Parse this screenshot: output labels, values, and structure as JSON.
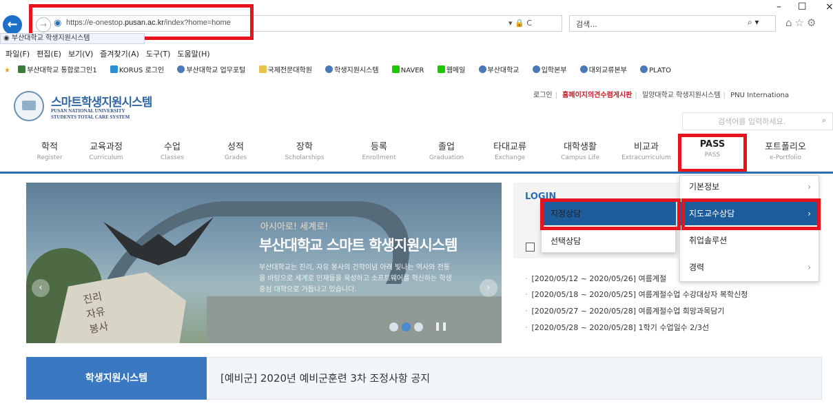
{
  "browser": {
    "url_host": "https://e-onestop.",
    "url_domain": "pusan.ac.kr",
    "url_path": "/index?home=home",
    "addr_tools": "▾ 🔒 C",
    "search_placeholder": "검색...",
    "search_drop": "⌕ ▾",
    "tab_title": "부산대학교 학생지원시스템",
    "minimize": "–",
    "maximize": "☐",
    "close": "×",
    "menu": [
      "파일(F)",
      "편집(E)",
      "보기(V)",
      "즐겨찾기(A)",
      "도구(T)",
      "도움말(H)"
    ],
    "favorites": [
      "부산대학교 통합로그인1",
      "KORUS 로그인",
      "부산대학교 업무포털",
      "국제전문대학원",
      "학생지원시스템",
      "NAVER",
      "웹메일",
      "부산대학교",
      "입학본부",
      "대외교류본부",
      "PLATO"
    ]
  },
  "site": {
    "logo_ko": "스마트학생지원시스템",
    "logo_en1": "PUSAN NATIONAL UNIVERSITY",
    "logo_en2": "STUDENTS TOTAL CARE SYSTEM",
    "top_links": [
      "로그인",
      "홈페이지의견수렴게시판",
      "밀양대학교 학생지원시스템",
      "PNU Internationa"
    ],
    "search_placeholder": "검색어를 입력하세요.",
    "search_icon": "⌕"
  },
  "nav": [
    {
      "ko": "학적",
      "en": "Register"
    },
    {
      "ko": "교육과정",
      "en": "Curriculum"
    },
    {
      "ko": "수업",
      "en": "Classes"
    },
    {
      "ko": "성적",
      "en": "Grades"
    },
    {
      "ko": "장학",
      "en": "Scholarships"
    },
    {
      "ko": "등록",
      "en": "Enrollment"
    },
    {
      "ko": "졸업",
      "en": "Graduation"
    },
    {
      "ko": "타대교류",
      "en": "Exchange"
    },
    {
      "ko": "대학생활",
      "en": "Campus Life"
    },
    {
      "ko": "비교과",
      "en": "Extracurriculum"
    },
    {
      "ko": "PASS",
      "en": "PASS"
    },
    {
      "ko": "포트폴리오",
      "en": "e-Portfolio"
    }
  ],
  "banner": {
    "line1": "아시아로! 세계로!",
    "line2": "부산대학교 스마트 학생지원시스템",
    "line3": "부산대학교는 진리, 자유 봉사의 건학이념 아래 빛나는 역사와 전통을 바탕으로 세계로 인재들을 육성하고 소프트웨어를 혁신하는 학생중심 대학으로 거듭나고 있습니다.",
    "rock_text": "진리 자유 봉사",
    "prev": "‹",
    "next": "›",
    "pause": "❚❚"
  },
  "login": {
    "title": "LOGIN"
  },
  "news": [
    "[2020/05/12 ~ 2020/05/26] 여름계절",
    "[2020/05/18 ~ 2020/05/25] 여름계절수업 수강대상자 복학신청",
    "[2020/05/27 ~ 2020/05/28] 여름계절수업 희망과목담기",
    "[2020/05/28 ~ 2020/05/28] 1학기 수업일수 2/3선"
  ],
  "notice": {
    "tab": "학생지원시스템",
    "text": "[예비군] 2020년 예비군훈련 3차 조정사항 공지"
  },
  "dropdown": {
    "items": [
      {
        "label": "기본정보",
        "chev": "›"
      },
      {
        "label": "지도교수상담",
        "chev": "›"
      },
      {
        "label": "취업솔루션",
        "chev": ""
      },
      {
        "label": "경력",
        "chev": "›"
      }
    ],
    "sub": [
      "지정상담",
      "선택상담"
    ]
  },
  "colors": {
    "accent": "#2d6db3",
    "highlight": "#e5141e",
    "active": "#1d5c9b"
  }
}
